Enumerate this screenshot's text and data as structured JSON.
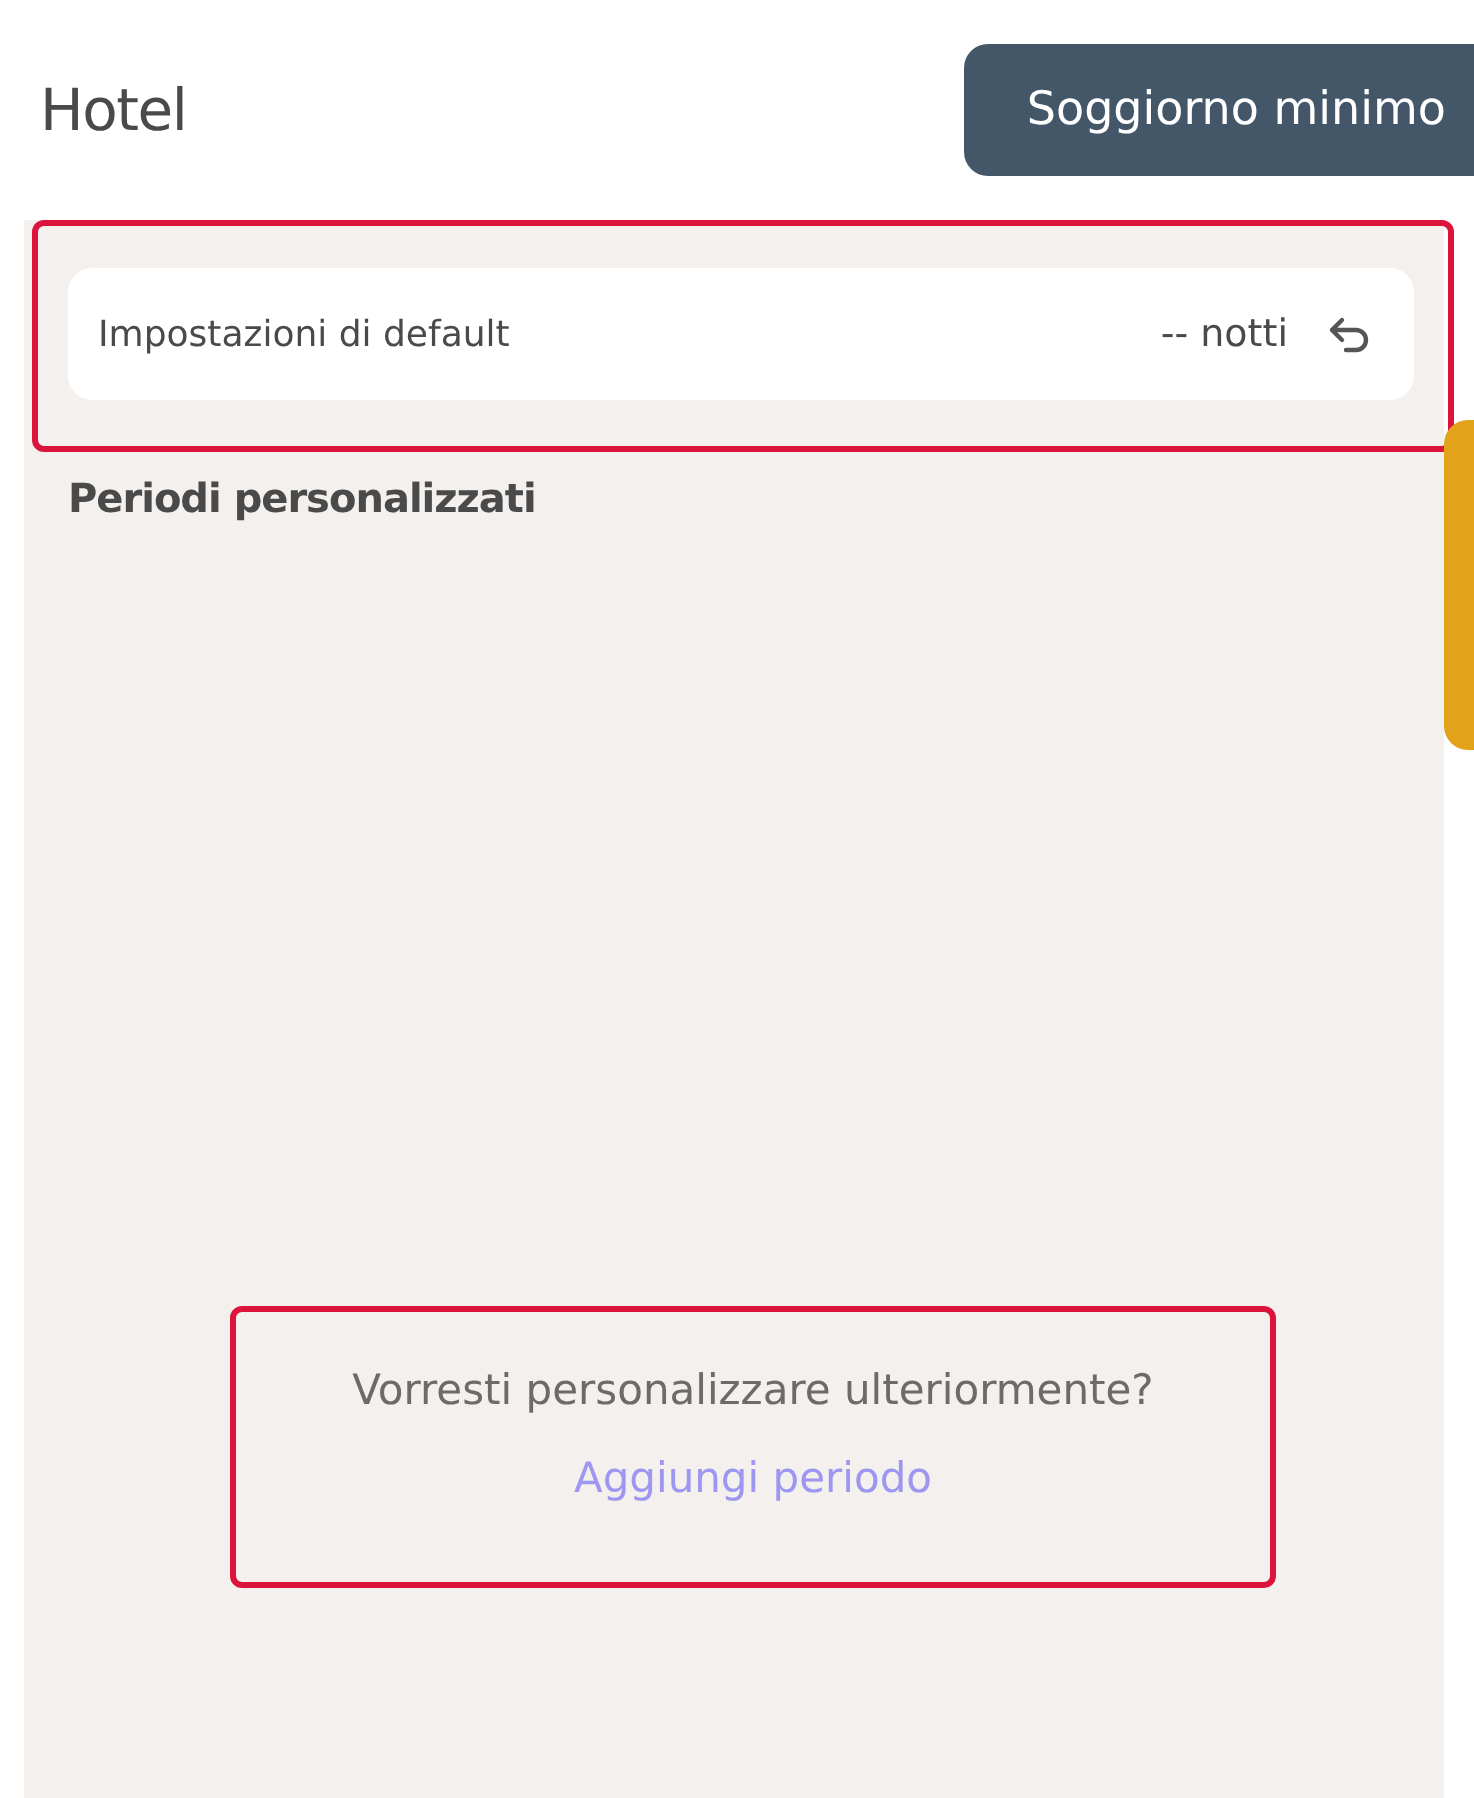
{
  "title": "Hotel",
  "action_button": {
    "label": "Soggiorno minimo"
  },
  "default_settings": {
    "label": "Impostazioni di default",
    "value": "-- notti"
  },
  "section_title": "Periodi personalizzati",
  "prompt": {
    "text": "Vorresti personalizzare ulteriormente?",
    "link": "Aggiungi periodo"
  }
}
